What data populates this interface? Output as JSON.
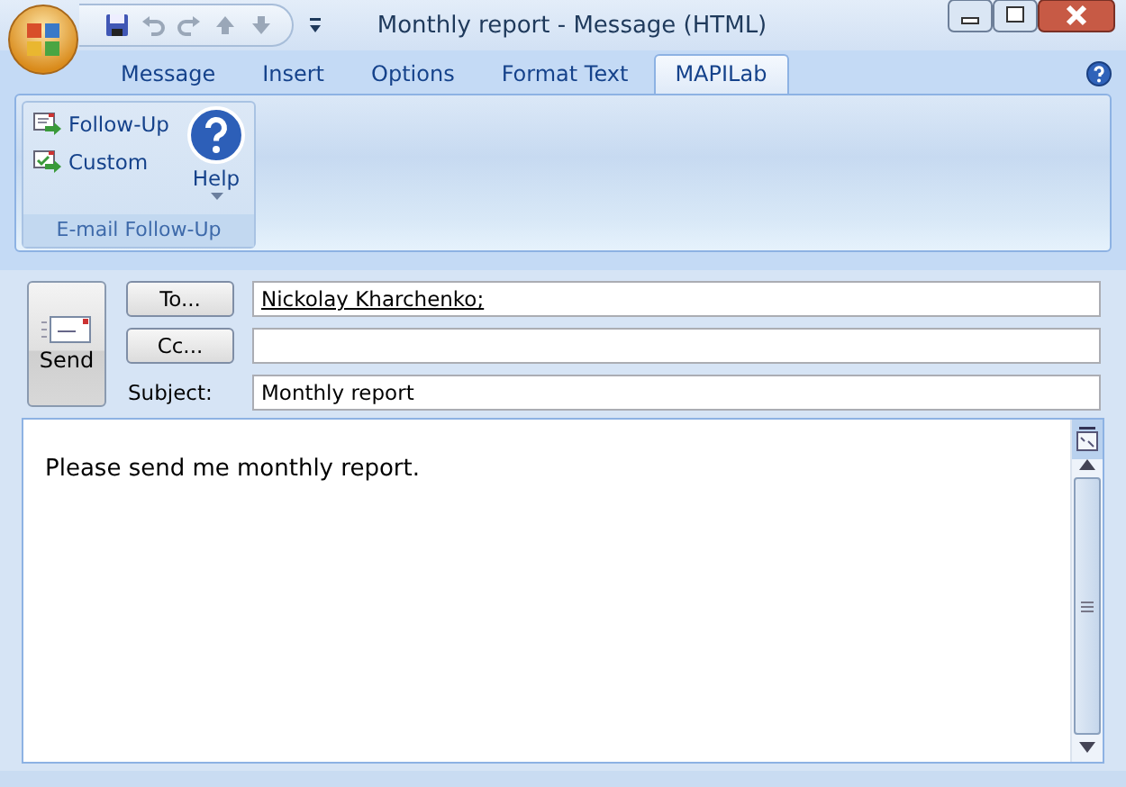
{
  "window": {
    "title": "Monthly report - Message (HTML)"
  },
  "tabs": [
    {
      "label": "Message",
      "selected": false
    },
    {
      "label": "Insert",
      "selected": false
    },
    {
      "label": "Options",
      "selected": false
    },
    {
      "label": "Format Text",
      "selected": false
    },
    {
      "label": "MAPILab",
      "selected": true
    }
  ],
  "ribbon_group": {
    "title": "E-mail Follow-Up",
    "commands": [
      {
        "label": "Follow-Up",
        "kind": "small"
      },
      {
        "label": "Custom",
        "kind": "small"
      },
      {
        "label": "Help",
        "kind": "large"
      }
    ]
  },
  "send_button": {
    "label": "Send"
  },
  "to": {
    "button": "To...",
    "value": "Nickolay Kharchenko;"
  },
  "cc": {
    "button": "Cc..."
  },
  "subject": {
    "label": "Subject:",
    "value": "Monthly report"
  },
  "body": {
    "text": "Please send me monthly report."
  }
}
